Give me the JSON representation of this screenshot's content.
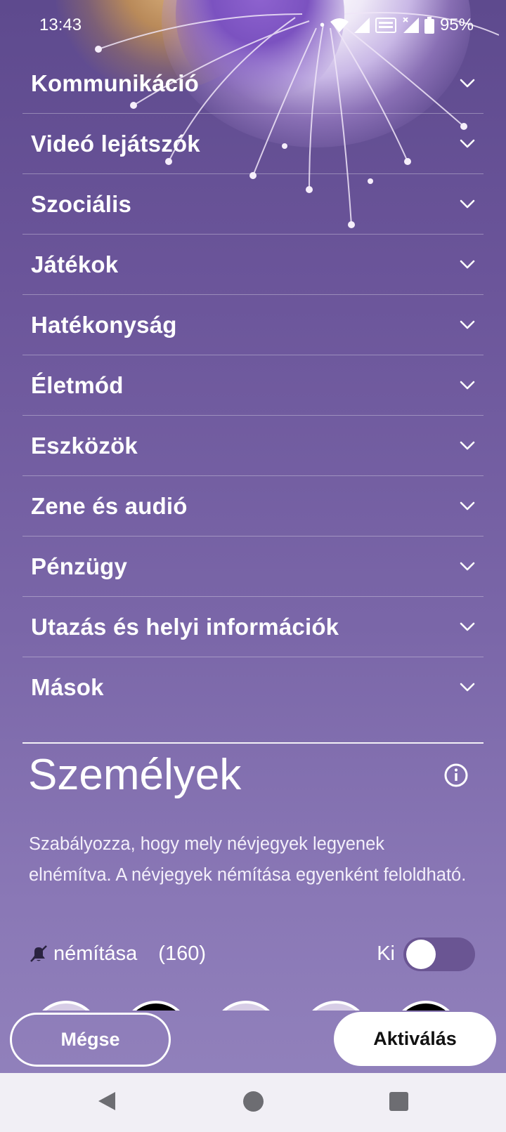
{
  "status_bar": {
    "time": "13:43",
    "battery": "95%",
    "icons": [
      "dot-icon",
      "wifi-icon",
      "signal-icon",
      "volte-icon",
      "signal-x-icon",
      "battery-icon"
    ]
  },
  "categories": [
    {
      "label": "Kommunikáció"
    },
    {
      "label": "Videó lejátszók"
    },
    {
      "label": "Szociális"
    },
    {
      "label": "Játékok"
    },
    {
      "label": "Hatékonyság"
    },
    {
      "label": "Életmód"
    },
    {
      "label": "Eszközök"
    },
    {
      "label": "Zene és audió"
    },
    {
      "label": "Pénzügy"
    },
    {
      "label": "Utazás és helyi információk"
    },
    {
      "label": "Mások"
    }
  ],
  "contacts_section": {
    "title": "Személyek",
    "description": "Szabályozza, hogy mely névjegyek legyenek elnémítva. A névjegyek némítása egyenként feloldható.",
    "mute_label": "némítása",
    "mute_count": "(160)",
    "toggle_label": "Ki",
    "toggle_on": false
  },
  "buttons": {
    "cancel": "Mégse",
    "activate": "Aktiválás"
  },
  "colors": {
    "background_top": "#5e4a8e",
    "background_bottom": "#9383bd",
    "toggle_track": "#6a5593",
    "navbar": "#f1eff5"
  }
}
